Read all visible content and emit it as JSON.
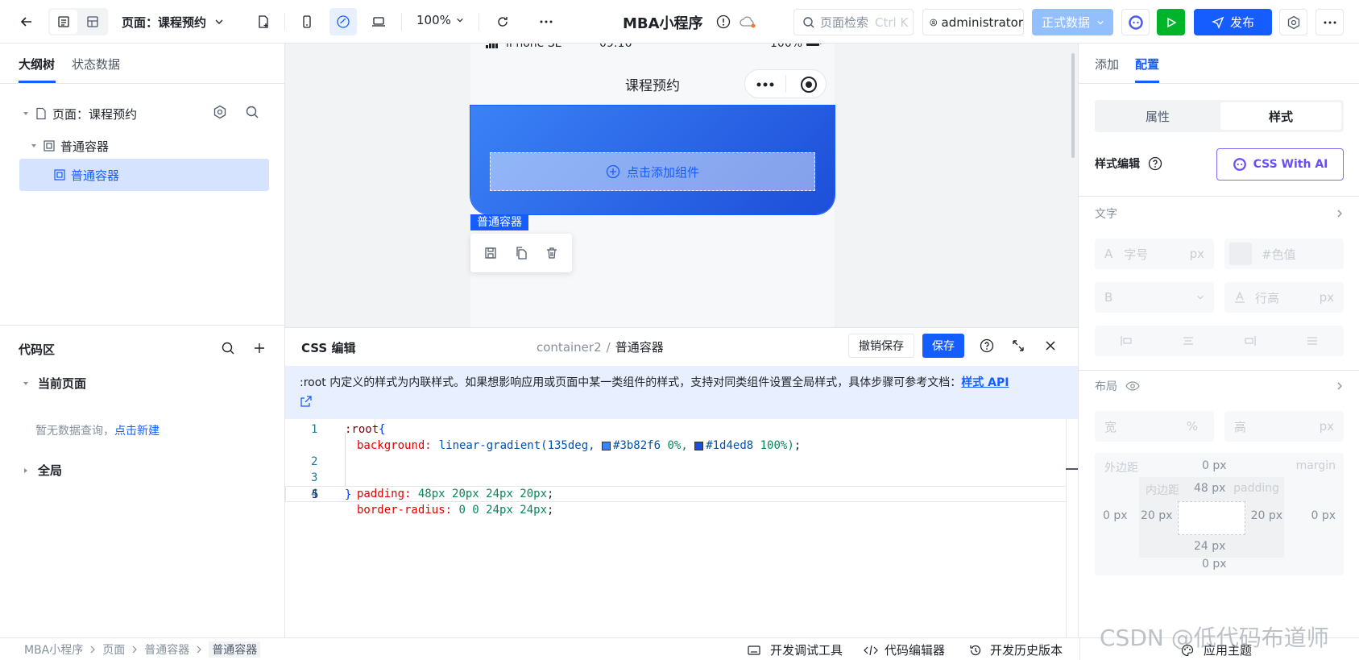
{
  "topbar": {
    "page_label": "页面：课程预约",
    "zoom": "100%",
    "app_title": "MBA小程序",
    "search_placeholder": "页面检索",
    "search_shortcut": "Ctrl K",
    "user": "administrator",
    "env": "正式数据",
    "publish": "发布"
  },
  "left": {
    "tabs": [
      "大纲树",
      "状态数据"
    ],
    "tree": {
      "page": "页面：课程预约",
      "container": "普通容器",
      "child": "普通容器"
    },
    "code_title": "代码区",
    "current_page": "当前页面",
    "empty_text": "暂无数据查询，",
    "create_link": "点击新建",
    "global": "全局"
  },
  "canvas": {
    "device": "iPhone SE",
    "time": "09:16",
    "battery": "100%",
    "nav_title": "课程预约",
    "add_component": "点击添加组件",
    "selection_label": "普通容器"
  },
  "css_editor": {
    "title": "CSS 编辑",
    "path_prefix": "container2",
    "path_sep": "/",
    "path_name": "普通容器",
    "undo_save": "撤销保存",
    "save": "保存",
    "notice": ":root 内定义的样式为内联样式。如果想影响应用或页面中某一类组件的样式，支持对同类组件设置全局样式，具体步骤可参考文档：",
    "notice_link": "样式 API",
    "lines": [
      {
        "num": "1",
        "sel": ":root",
        "brace": " {"
      },
      {
        "num": "2",
        "prop": "background:",
        "fn": "linear-gradient(135deg, ",
        "c1": "#3b82f6",
        "p1": " 0%, ",
        "c2": "#1d4ed8",
        "p2": " 100%)",
        "end": ";"
      },
      {
        "num": "3",
        "prop": "padding:",
        "val": "48px 20px 24px 20px",
        "end": ";"
      },
      {
        "num": "4",
        "prop": "border-radius:",
        "val": "0 0 24px 24px",
        "end": ";"
      },
      {
        "num": "5",
        "brace": "}"
      }
    ]
  },
  "right": {
    "tabs": [
      "添加",
      "配置"
    ],
    "seg": [
      "属性",
      "样式"
    ],
    "style_edit": "样式编辑",
    "css_ai": "CSS With AI",
    "text_section": "文字",
    "font_size_ph": "字号",
    "px": "px",
    "color_ph": "#色值",
    "weight": "B",
    "line_height_ph": "行高",
    "layout_section": "布局",
    "width_label": "宽",
    "percent": "%",
    "height_label": "高",
    "margin_label": "外边距",
    "margin_en": "margin",
    "padding_label": "内边距",
    "padding_en": "padding",
    "margin_top": "0 px",
    "margin_left": "0 px",
    "margin_right": "0 px",
    "margin_bottom": "0 px",
    "padding_top": "48 px",
    "padding_left": "20 px",
    "padding_right": "20 px",
    "padding_bottom": "24 px"
  },
  "status": {
    "crumbs": [
      "MBA小程序",
      "页面",
      "普通容器",
      "普通容器"
    ],
    "devtools": "开发调试工具",
    "code_editor": "代码编辑器",
    "history": "开发历史版本",
    "theme": "应用主题",
    "watermark": "CSDN @低代码布道师"
  },
  "colors": {
    "primary": "#165dff",
    "gradient_start": "#3b82f6",
    "gradient_end": "#1d4ed8",
    "green": "#00b42a"
  }
}
